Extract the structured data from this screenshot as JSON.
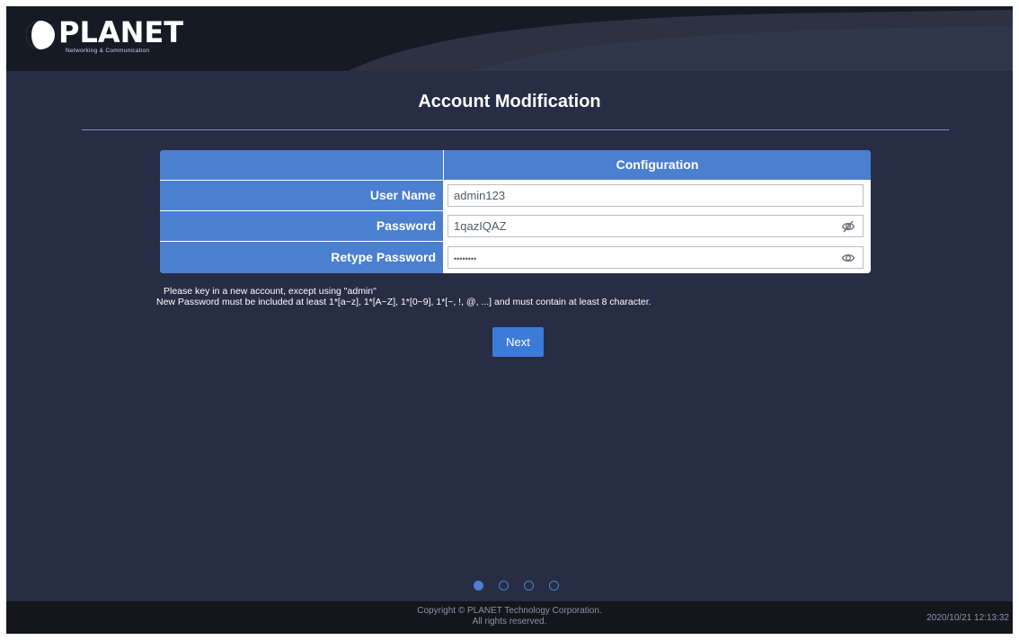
{
  "brand": {
    "name": "PLANET",
    "tagline": "Networking & Communication"
  },
  "page": {
    "title": "Account Modification"
  },
  "form": {
    "header": "Configuration",
    "rows": [
      {
        "label": "User Name",
        "value": "admin123"
      },
      {
        "label": "Password",
        "value": "1qazIQAZ",
        "icon": "eye-slash-icon"
      },
      {
        "label": "Retype Password",
        "value": "••••••••",
        "icon": "eye-icon"
      }
    ]
  },
  "notes": {
    "line1": "Please key in a new account, except using \"admin\"",
    "line2": "New Password must be included at least 1*[a~z], 1*[A~Z], 1*[0~9], 1*[~, !, @, ...] and must contain at least 8 character."
  },
  "actions": {
    "next_label": "Next"
  },
  "pager": {
    "total": 4,
    "active": 1
  },
  "footer": {
    "copyright": "Copyright © PLANET Technology Corporation.",
    "rights": "All rights reserved.",
    "datetime": "2020/10/21 12:13:32"
  },
  "colors": {
    "background": "#262d44",
    "accent": "#4b7fd0",
    "button": "#3d7bd9",
    "header": "#161a24",
    "footer": "#14161c"
  }
}
